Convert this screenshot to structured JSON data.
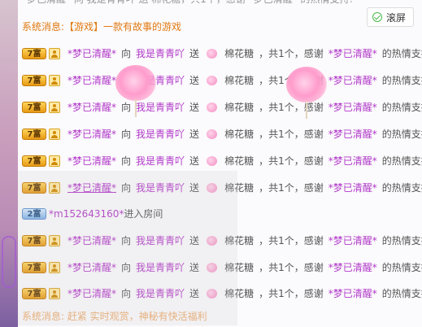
{
  "scroll_button": {
    "label": "滚屏",
    "icon": "check-circle-icon"
  },
  "top_partial": {
    "text": "*梦已清醒* 向 我是青青吖 送 棉花糖，共1个，感谢 *梦已清醒* 的热情支持!"
  },
  "system_message": {
    "label": "系统消息:",
    "content": "【游戏】一款有故事的游戏"
  },
  "gift_rows": [
    {
      "badge": "7富",
      "sender": "*梦已清醒*",
      "verb": "向",
      "recipient": "我是青青吖",
      "action": "送",
      "gift": "棉花糖",
      "count": "，共1个，感谢",
      "thanks_user": "*梦已清醒*",
      "tail": "的热情支持!"
    },
    {
      "badge": "7富",
      "sender": "*梦已清醒*",
      "verb": "向",
      "recipient": "我是青青吖",
      "action": "送",
      "gift": "棉花糖",
      "count": "，共1个，感谢",
      "thanks_user": "*梦已清醒*",
      "tail": "的热情支持!"
    },
    {
      "badge": "7富",
      "sender": "*梦已清醒*",
      "verb": "向",
      "recipient": "我是青青吖",
      "action": "送",
      "gift": "棉花糖",
      "count": "，共1个，感谢",
      "thanks_user": "*梦已清醒*",
      "tail": "的热情支持!"
    },
    {
      "badge": "7富",
      "sender": "*梦已清醒*",
      "verb": "向",
      "recipient": "我是青青吖",
      "action": "送",
      "gift": "棉花糖",
      "count": "，共1个，感谢",
      "thanks_user": "*梦已清醒*",
      "tail": "的热情支持!"
    },
    {
      "badge": "7富",
      "sender": "*梦已清醒*",
      "verb": "向",
      "recipient": "我是青青吖",
      "action": "送",
      "gift": "棉花糖",
      "count": "，共1个，感谢",
      "thanks_user": "*梦已清醒*",
      "tail": "的热情支持!"
    },
    {
      "badge": "7富",
      "sender": "*梦已清醒*",
      "verb": "向",
      "recipient": "我是青青吖",
      "action": "送",
      "gift": "棉花糖",
      "count": "，共1个，感谢",
      "thanks_user": "*梦已清醒*",
      "tail": "的热情支持!"
    }
  ],
  "enter_row": {
    "badge": "2富",
    "user": "*m152643160*",
    "text": "进入房间"
  },
  "gift_rows_2": [
    {
      "badge": "7富",
      "sender": "*梦已清醒*",
      "verb": "向",
      "recipient": "我是青青吖",
      "action": "送",
      "gift": "棉花糖",
      "count": "，共1个，感谢",
      "thanks_user": "*梦已清醒*",
      "tail": "的热情支持!"
    },
    {
      "badge": "7富",
      "sender": "*梦已清醒*",
      "verb": "向",
      "recipient": "我是青青吖",
      "action": "送",
      "gift": "棉花糖",
      "count": "，共1个，感谢",
      "thanks_user": "*梦已清醒*",
      "tail": "的热情支持!"
    },
    {
      "badge": "7富",
      "sender": "*梦已清醒*",
      "verb": "向",
      "recipient": "我是青青吖",
      "action": "送",
      "gift": "棉花糖",
      "count": "，共1个，感谢",
      "thanks_user": "*梦已清醒*",
      "tail": "的热情支持!"
    }
  ],
  "bottom_partial": {
    "text": "系统消息: 赶紧 实时观赏，神秘有快活福利"
  },
  "colors": {
    "purple": "#b13ac9",
    "orange": "#e07a12",
    "badge_gold": "#f2b52a"
  }
}
